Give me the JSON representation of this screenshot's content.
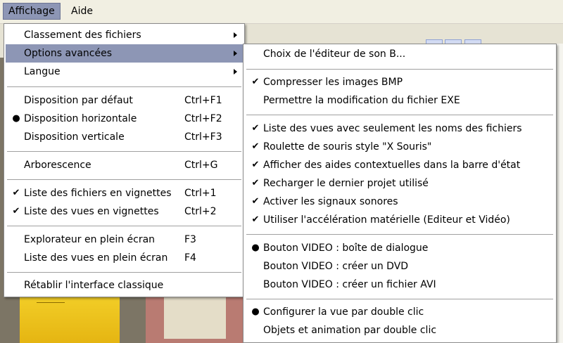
{
  "menubar": {
    "items": [
      {
        "label": "Affichage"
      },
      {
        "label": "Aide"
      }
    ]
  },
  "menu_affichage": {
    "items": [
      {
        "label": "Classement des fichiers",
        "shortcut": "",
        "mark": "",
        "submenu": true
      },
      {
        "label": "Options avancées",
        "shortcut": "",
        "mark": "",
        "submenu": true,
        "highlighted": true
      },
      {
        "label": "Langue",
        "shortcut": "",
        "mark": "",
        "submenu": true
      },
      {
        "label": "Disposition par défaut",
        "shortcut": "Ctrl+F1",
        "mark": ""
      },
      {
        "label": "Disposition horizontale",
        "shortcut": "Ctrl+F2",
        "mark": "●"
      },
      {
        "label": "Disposition verticale",
        "shortcut": "Ctrl+F3",
        "mark": ""
      },
      {
        "label": "Arborescence",
        "shortcut": "Ctrl+G",
        "mark": ""
      },
      {
        "label": "Liste des fichiers en vignettes",
        "shortcut": "Ctrl+1",
        "mark": "✔"
      },
      {
        "label": "Liste des vues en vignettes",
        "shortcut": "Ctrl+2",
        "mark": "✔"
      },
      {
        "label": "Explorateur en plein écran",
        "shortcut": "F3",
        "mark": ""
      },
      {
        "label": "Liste des vues en plein écran",
        "shortcut": "F4",
        "mark": ""
      },
      {
        "label": "Rétablir l'interface classique",
        "shortcut": "",
        "mark": ""
      }
    ]
  },
  "menu_options": {
    "items": [
      {
        "label": "Choix de l'éditeur de son B...",
        "mark": ""
      },
      {
        "label": "Compresser les images BMP",
        "mark": "✔"
      },
      {
        "label": "Permettre la modification du fichier EXE",
        "mark": ""
      },
      {
        "label": "Liste des vues avec seulement les noms des fichiers",
        "mark": "✔"
      },
      {
        "label": "Roulette de souris style \"X Souris\"",
        "mark": "✔"
      },
      {
        "label": "Afficher des aides contextuelles dans la barre d'état",
        "mark": "✔"
      },
      {
        "label": "Recharger le dernier projet utilisé",
        "mark": "✔"
      },
      {
        "label": "Activer les signaux sonores",
        "mark": "✔"
      },
      {
        "label": "Utiliser l'accélération matérielle (Editeur et Vidéo)",
        "mark": "✔"
      },
      {
        "label": "Bouton VIDEO : boîte de dialogue",
        "mark": "●"
      },
      {
        "label": "Bouton VIDEO : créer un DVD",
        "mark": ""
      },
      {
        "label": "Bouton VIDEO : créer un fichier AVI",
        "mark": ""
      },
      {
        "label": "Configurer la vue par double clic",
        "mark": "●"
      },
      {
        "label": "Objets et animation par double clic",
        "mark": ""
      }
    ]
  },
  "colors": {
    "highlight": "#8d96b5",
    "menu_bg": "#ffffff",
    "menubar_bg": "#f1efe2"
  }
}
